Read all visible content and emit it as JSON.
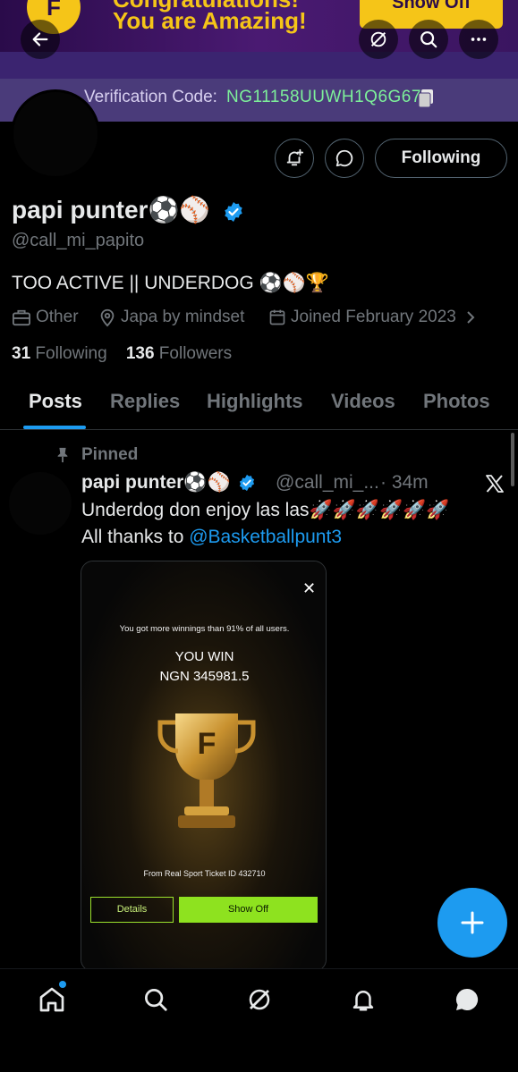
{
  "banner": {
    "title_line1": "Congratulations!",
    "title_line2": "You are Amazing!",
    "button": "Show Off",
    "verification_label": "Verification Code:",
    "verification_code": "NG11158UUWH1Q6G67"
  },
  "profile": {
    "display_name": "papi punter⚽⚾",
    "handle": "@call_mi_papito",
    "bio": "TOO ACTIVE || UNDERDOG ⚽⚾🏆",
    "category": "Other",
    "location": "Japa by mindset",
    "joined": "Joined February 2023",
    "following_count": "31",
    "following_label": "Following",
    "followers_count": "136",
    "followers_label": "Followers",
    "follow_button": "Following"
  },
  "tabs": [
    "Posts",
    "Replies",
    "Highlights",
    "Videos",
    "Photos"
  ],
  "post": {
    "pinned_label": "Pinned",
    "author_name": "papi punter⚽⚾",
    "author_handle": "@call_mi_...",
    "time": "· 34m",
    "text_line1": "Underdog don enjoy las las🚀🚀🚀🚀🚀🚀",
    "text_line2_prefix": "All thanks to ",
    "mention": "@Basketballpunt3",
    "media": {
      "winnings_text": "You got more winnings than 91% of all users.",
      "you_win": "YOU WIN",
      "amount": "NGN 345981.5",
      "ticket_text": "From Real Sport Ticket ID 432710",
      "details_button": "Details",
      "showoff_button": "Show Off"
    }
  },
  "colors": {
    "accent": "#1d9bf0",
    "background": "#000000",
    "muted_text": "#71767b",
    "verification_code": "#7df09a"
  }
}
